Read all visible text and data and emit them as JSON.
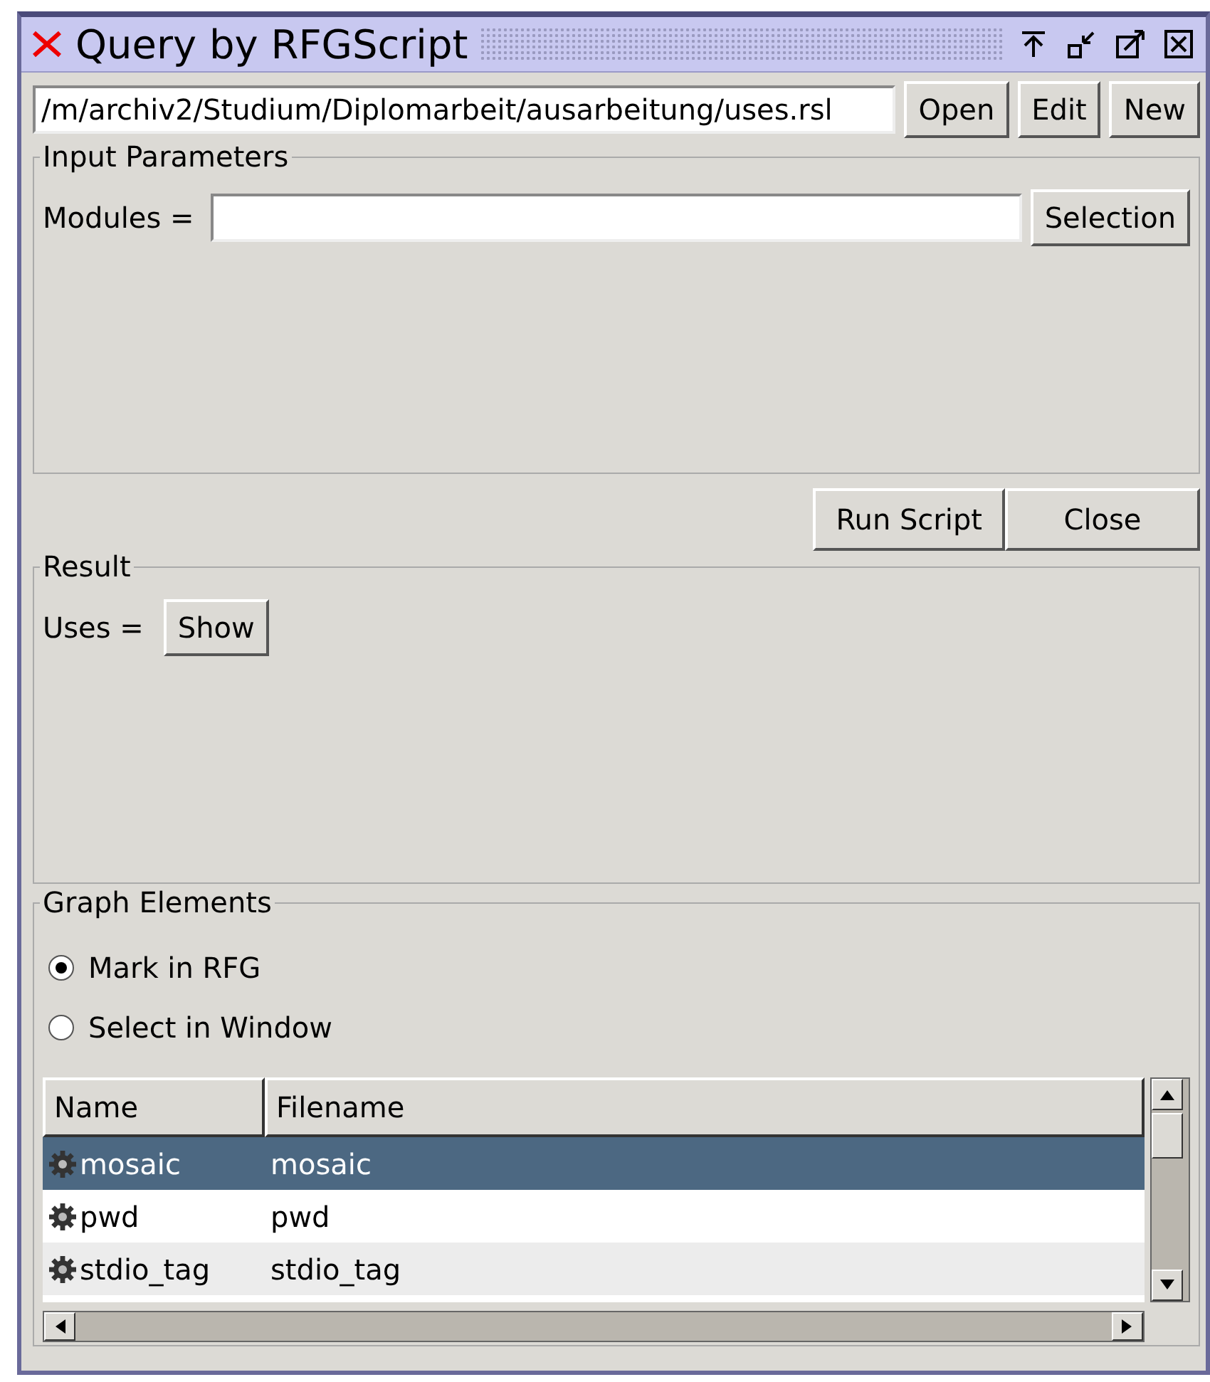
{
  "window": {
    "title": "Query by RFGScript"
  },
  "script_path": {
    "value": "/m/archiv2/Studium/Diplomarbeit/ausarbeitung/uses.rsl"
  },
  "script_buttons": [
    "Open",
    "Edit",
    "New"
  ],
  "input_parameters": {
    "title": "Input Parameters",
    "label": "Modules =",
    "button": "Selection"
  },
  "actions": [
    "Run Script",
    "Close"
  ],
  "result": {
    "title": "Result",
    "label": "Uses =",
    "button": "Show"
  },
  "graph_elements": {
    "title": "Graph Elements",
    "options": [
      {
        "label": "Mark in RFG",
        "selected": true
      },
      {
        "label": "Select in Window",
        "selected": false
      }
    ],
    "table": {
      "columns": [
        "Name",
        "Filename"
      ],
      "rows": [
        {
          "name": "mosaic",
          "filename": "mosaic",
          "selected": true
        },
        {
          "name": "pwd",
          "filename": "pwd",
          "selected": false
        },
        {
          "name": "stdio_tag",
          "filename": "stdio_tag",
          "selected": false
        }
      ]
    }
  }
}
